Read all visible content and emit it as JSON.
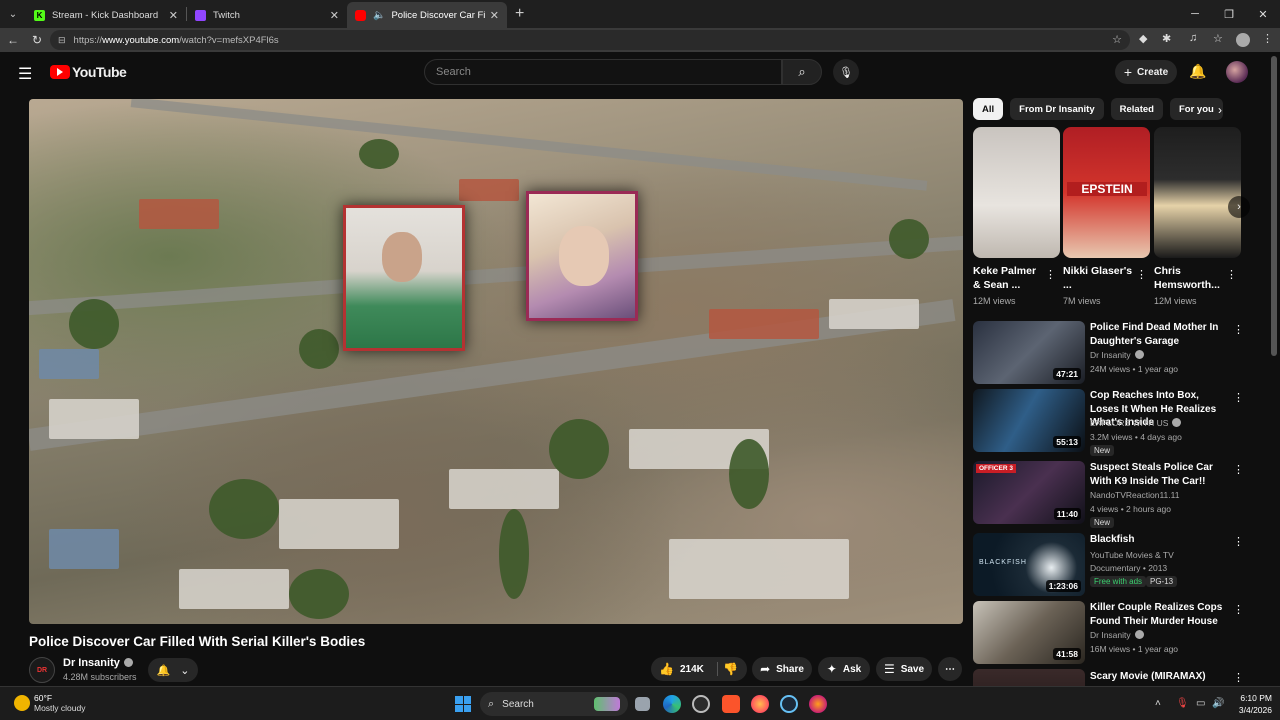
{
  "browser": {
    "tabs": [
      {
        "title": "Stream - Kick Dashboard",
        "fav_color": "#53fc18",
        "fav_letter": "K"
      },
      {
        "title": "Twitch",
        "fav_color": "#9146ff",
        "fav_letter": ""
      },
      {
        "title": "Police Discover Car Filled With",
        "fav_color": "#ff0000",
        "fav_letter": ""
      }
    ],
    "url_prefix": "https://",
    "url_host": "www.youtube.com",
    "url_path": "/watch?v=mefsXP4Fl6s"
  },
  "youtube": {
    "logo_text": "YouTube",
    "search_placeholder": "Search",
    "create_label": "Create"
  },
  "video": {
    "title": "Police Discover Car Filled With Serial Killer's Bodies",
    "channel": "Dr Insanity",
    "channel_avatar_text": "DR",
    "subscribers": "4.28M subscribers",
    "likes": "214K",
    "share_label": "Share",
    "ask_label": "Ask",
    "save_label": "Save"
  },
  "chips": [
    "All",
    "From Dr Insanity",
    "Related",
    "For you"
  ],
  "shorts": [
    {
      "title": "Keke Palmer & Sean ...",
      "views": "12M views"
    },
    {
      "title": "Nikki Glaser's ...",
      "views": "7M views",
      "overlay": "EPSTEIN"
    },
    {
      "title": "Chris Hemsworth...",
      "views": "12M views"
    }
  ],
  "recommendations": [
    {
      "title": "Police Find Dead Mother In Daughter's Garage",
      "channel": "Dr Insanity",
      "meta": "24M views • 1 year ago",
      "duration": "47:21"
    },
    {
      "title": "Cop Reaches Into Box, Loses It When He Realizes What's Inside",
      "channel": "EXPLORE WITH US",
      "meta": "3.2M views • 4 days ago",
      "duration": "55:13",
      "badge": "New"
    },
    {
      "title": "Suspect Steals Police Car With K9 Inside  The Car!!",
      "channel": "NandoTVReaction11.11",
      "meta": "4 views • 2 hours ago",
      "duration": "11:40",
      "badge": "New",
      "overlay": "OFFICER 3"
    },
    {
      "title": "Blackfish",
      "channel": "YouTube Movies & TV",
      "meta": "Documentary • 2013",
      "duration": "1:23:06",
      "free": "Free with ads",
      "rating": "PG-13",
      "overlay": "BLACKFISH"
    },
    {
      "title": "Killer Couple Realizes Cops Found Their Murder House",
      "channel": "Dr Insanity",
      "meta": "16M views • 1 year ago",
      "duration": "41:58"
    },
    {
      "title": "Scary Movie (MIRAMAX)"
    }
  ],
  "taskbar": {
    "temp": "60°F",
    "weather": "Mostly cloudy",
    "search": "Search",
    "time": "6:10 PM",
    "date": "3/4/2026"
  }
}
